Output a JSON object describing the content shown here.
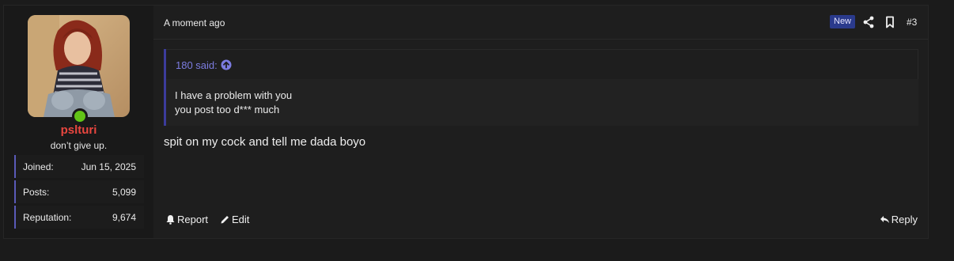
{
  "post": {
    "time": "A moment ago",
    "badge": "New",
    "number": "#3",
    "quote": {
      "author": "180 said:",
      "lines": [
        "I have a problem with you",
        "you post too d*** much"
      ]
    },
    "message": "spit on my cock and tell me dada boyo",
    "actions": {
      "report": "Report",
      "edit": "Edit",
      "reply": "Reply"
    }
  },
  "user": {
    "name": "pslturi",
    "title": "don’t give up.",
    "stats": [
      {
        "label": "Joined:",
        "value": "Jun 15, 2025"
      },
      {
        "label": "Posts:",
        "value": "5,099"
      },
      {
        "label": "Reputation:",
        "value": "9,674"
      }
    ]
  },
  "colors": {
    "username": "#e8463f",
    "accent": "#5a5ab8",
    "online": "#62c416",
    "badge_bg": "#2a3a8c"
  },
  "icons": [
    "share-icon",
    "bookmark-icon",
    "quote-jump-icon",
    "bell-icon",
    "pencil-icon",
    "reply-icon"
  ]
}
